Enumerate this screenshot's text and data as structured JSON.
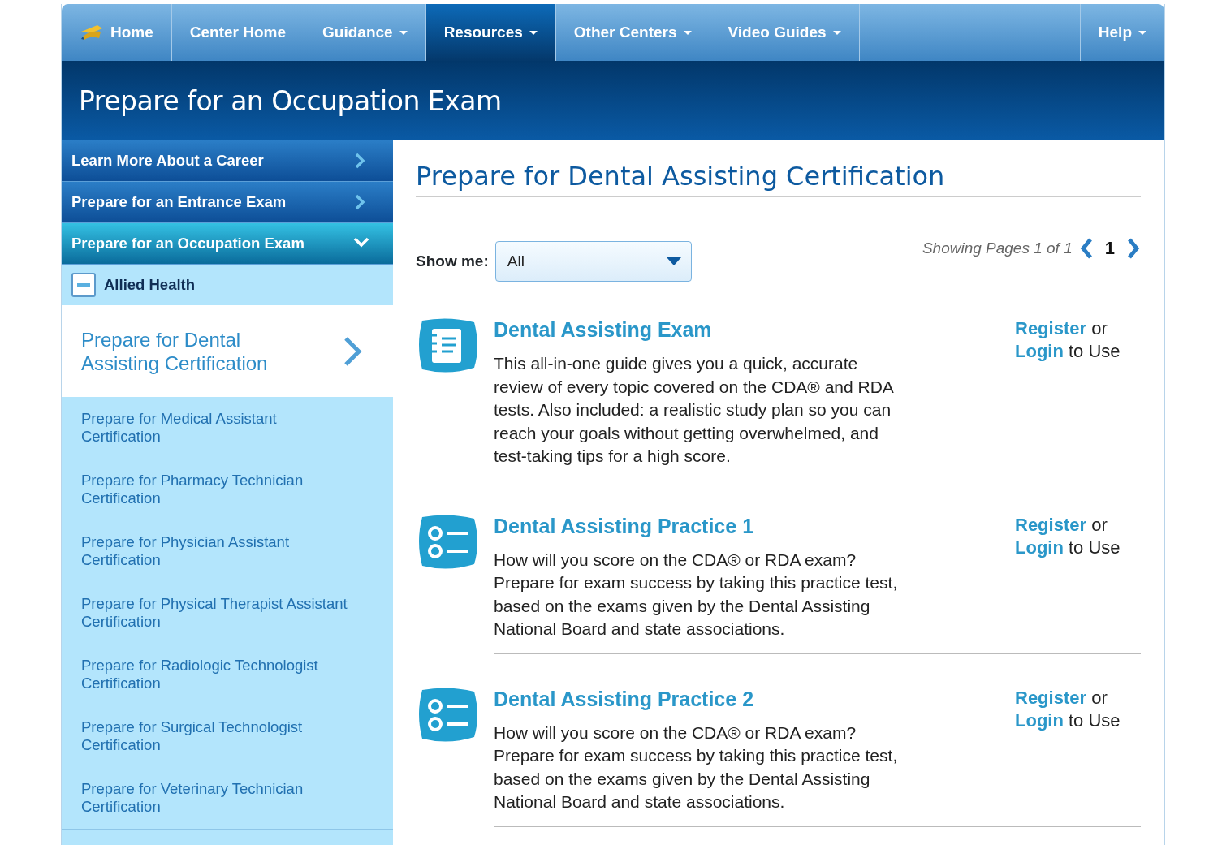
{
  "nav": {
    "items": [
      {
        "label": "Home",
        "kind": "home",
        "dropdown": false,
        "selected": false
      },
      {
        "label": "Center Home",
        "kind": "link",
        "dropdown": false,
        "selected": false
      },
      {
        "label": "Guidance",
        "kind": "link",
        "dropdown": true,
        "selected": false
      },
      {
        "label": "Resources",
        "kind": "link",
        "dropdown": true,
        "selected": true
      },
      {
        "label": "Other Centers",
        "kind": "link",
        "dropdown": true,
        "selected": false
      },
      {
        "label": "Video Guides",
        "kind": "link",
        "dropdown": true,
        "selected": false
      }
    ],
    "help": {
      "label": "Help",
      "dropdown": true
    }
  },
  "banner": {
    "title": "Prepare for an Occupation Exam"
  },
  "sidebar": {
    "sections": [
      {
        "label": "Learn More About a Career",
        "expanded": false
      },
      {
        "label": "Prepare for an Entrance Exam",
        "expanded": false
      },
      {
        "label": "Prepare for an Occupation Exam",
        "expanded": true
      }
    ],
    "category": {
      "label": "Allied Health",
      "expanded": true
    },
    "items": [
      {
        "label": "Prepare for Dental Assisting Certification",
        "selected": true
      },
      {
        "label": "Prepare for Medical Assistant Certification",
        "selected": false
      },
      {
        "label": "Prepare for Pharmacy Technician Certification",
        "selected": false
      },
      {
        "label": "Prepare for Physician Assistant Certification",
        "selected": false
      },
      {
        "label": "Prepare for Physical Therapist Assistant Certification",
        "selected": false
      },
      {
        "label": "Prepare for Radiologic Technologist Certification",
        "selected": false
      },
      {
        "label": "Prepare for Surgical Technologist Certification",
        "selected": false
      },
      {
        "label": "Prepare for Veterinary Technician Certification",
        "selected": false
      }
    ]
  },
  "main": {
    "title": "Prepare for Dental Assisting Certification",
    "filter": {
      "label": "Show me:",
      "value": "All"
    },
    "pagination": {
      "summary": "Showing Pages 1 of 1",
      "page": "1"
    },
    "products": [
      {
        "kind": "ebook",
        "title": "Dental Assisting Exam",
        "description": "This all-in-one guide gives you a quick, accurate review of every topic covered on the CDA® and RDA tests. Also included: a realistic study plan so you can reach your goals without getting overwhelmed, and test-taking tips for a high score.",
        "register": "Register",
        "or": "or",
        "login": "Login",
        "to_use": "to Use"
      },
      {
        "kind": "practice",
        "title": "Dental Assisting Practice 1",
        "description": "How will you score on the CDA® or RDA exam? Prepare for exam success by taking this practice test, based on the exams given by the Dental Assisting National Board and state associations.",
        "register": "Register",
        "or": "or",
        "login": "Login",
        "to_use": "to Use"
      },
      {
        "kind": "practice",
        "title": "Dental Assisting Practice 2",
        "description": "How will you score on the CDA® or RDA exam? Prepare for exam success by taking this practice test, based on the exams given by the Dental Assisting National Board and state associations.",
        "register": "Register",
        "or": "or",
        "login": "Login",
        "to_use": "to Use"
      }
    ]
  }
}
